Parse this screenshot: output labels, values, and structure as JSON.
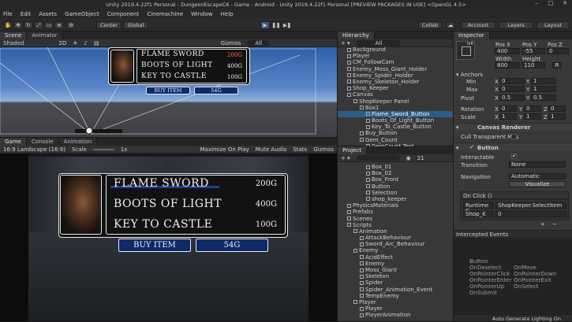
{
  "window": {
    "title": "Unity 2019.4.22f1 Personal - DungeonEscapeC6 - Game - Android - Unity 2019.4.22f1 Personal [PREVIEW PACKAGES IN USE] <OpenGL 4.5>"
  },
  "menu": [
    "File",
    "Edit",
    "Assets",
    "GameObject",
    "Component",
    "Cinemachine",
    "Window",
    "Help"
  ],
  "toolbar": {
    "center": "Center",
    "global": "Global",
    "collab": "Collab",
    "account": "Account",
    "layers": "Layers",
    "layout": "Layout"
  },
  "scene": {
    "tabs": [
      "Scene",
      "Animator"
    ],
    "shading": "Shaded",
    "mode2d": "2D",
    "gizmos": "Gizmos",
    "search": "All"
  },
  "game": {
    "tabs": [
      "Game",
      "Console",
      "Animation"
    ],
    "resolution": "16:9 Landscape (16:9)",
    "scale_label": "Scale",
    "scale_value": "1x",
    "options": [
      "Maximize On Play",
      "Mute Audio",
      "Stats",
      "Gizmos"
    ]
  },
  "shop": {
    "items": [
      {
        "name": "FLAME SWORD",
        "price": "200G"
      },
      {
        "name": "BOOTS OF LIGHT",
        "price": "400G"
      },
      {
        "name": "KEY TO CASTLE",
        "price": "100G"
      }
    ],
    "buy_label": "BUY ITEM",
    "gems": "54G"
  },
  "hierarchy": {
    "title": "Hierarchy",
    "search": "All",
    "rows": [
      {
        "label": "Background",
        "indent": 1,
        "sel": false
      },
      {
        "label": "Player",
        "indent": 1,
        "sel": false
      },
      {
        "label": "CM_FollowCam",
        "indent": 1,
        "sel": false
      },
      {
        "label": "Enemy_Moss_Giant_Holder",
        "indent": 1,
        "sel": false
      },
      {
        "label": "Enemy_Spider_Holder",
        "indent": 1,
        "sel": false
      },
      {
        "label": "Enemy_Skeleton_Holder",
        "indent": 1,
        "sel": false
      },
      {
        "label": "Shop_Keeper",
        "indent": 1,
        "sel": false
      },
      {
        "label": "Canvas",
        "indent": 1,
        "sel": false
      },
      {
        "label": "ShopKeeper Panel",
        "indent": 2,
        "sel": false
      },
      {
        "label": "Box1",
        "indent": 3,
        "sel": false
      },
      {
        "label": "Flame_Sword_Button",
        "indent": 4,
        "sel": true
      },
      {
        "label": "Boots_Of_Light_Button",
        "indent": 4,
        "sel": false
      },
      {
        "label": "Key_To_Castle_Button",
        "indent": 4,
        "sel": false
      },
      {
        "label": "Buy_Button",
        "indent": 3,
        "sel": false
      },
      {
        "label": "Gem_Count",
        "indent": 3,
        "sel": false
      },
      {
        "label": "GemCount Text",
        "indent": 4,
        "sel": false
      }
    ]
  },
  "project": {
    "title": "Project",
    "search": "",
    "count": "21",
    "rows": [
      {
        "label": "Box_01",
        "indent": 4
      },
      {
        "label": "Box_02",
        "indent": 4
      },
      {
        "label": "Box_Front",
        "indent": 4
      },
      {
        "label": "Button",
        "indent": 4
      },
      {
        "label": "Selection",
        "indent": 4
      },
      {
        "label": "shop_keeper",
        "indent": 4
      },
      {
        "label": "PhysicsMaterials",
        "indent": 1
      },
      {
        "label": "Prefabs",
        "indent": 1
      },
      {
        "label": "Scenes",
        "indent": 1
      },
      {
        "label": "Scripts",
        "indent": 1
      },
      {
        "label": "Animation",
        "indent": 2
      },
      {
        "label": "AttackBehaviour",
        "indent": 3
      },
      {
        "label": "Sword_Arc_Behaviour",
        "indent": 3
      },
      {
        "label": "Enemy",
        "indent": 2
      },
      {
        "label": "AcidEffect",
        "indent": 3
      },
      {
        "label": "Enemy",
        "indent": 3
      },
      {
        "label": "Moss_Giant",
        "indent": 3
      },
      {
        "label": "Skeleton",
        "indent": 3
      },
      {
        "label": "Spider",
        "indent": 3
      },
      {
        "label": "Spider_Animation_Event",
        "indent": 3
      },
      {
        "label": "TempEnemy",
        "indent": 3
      },
      {
        "label": "Player",
        "indent": 2
      },
      {
        "label": "Player",
        "indent": 3
      },
      {
        "label": "PlayerAnimation",
        "indent": 3
      }
    ]
  },
  "inspector": {
    "title": "Inspector",
    "anchor_preset": "left",
    "posx_label": "Pos X",
    "posy_label": "Pos Y",
    "posz_label": "Pos Z",
    "posx": "400",
    "posy": "-55",
    "posz": "0",
    "width_label": "Width",
    "height_label": "Height",
    "width": "800",
    "height": "110",
    "anchors": "Anchors",
    "min": "Min",
    "max": "Max",
    "min_x": "0",
    "min_y": "1",
    "max_x": "0",
    "max_y": "1",
    "pivot": "Pivot",
    "pivot_x": "0.5",
    "pivot_y": "0.5",
    "rotation": "Rotation",
    "rot_x": "0",
    "rot_y": "0",
    "rot_z": "0",
    "scale": "Scale",
    "sc_x": "1",
    "sc_y": "1",
    "sc_z": "1",
    "canvas_renderer": "Canvas Renderer",
    "cull": "Cull Transparent Mes",
    "button": "Button",
    "interactable": "Interactable",
    "transition": "Transition",
    "transition_value": "None",
    "navigation": "Navigation",
    "navigation_value": "Automatic",
    "visualize": "Visualize",
    "onclick": "On Click ()",
    "runtime": "Runtime C",
    "method": "ShopKeeper.SelectItem",
    "target": "Shop_K",
    "arg": "0",
    "intercepted": "Intercepted Events",
    "events_title": "Button",
    "events_left": [
      "OnDeselect",
      "OnPointerClick",
      "OnPointerEnter",
      "OnPointerUp",
      "OnSubmit"
    ],
    "events_right": [
      "OnMove",
      "OnPointerDown",
      "OnPointerExit",
      "OnSelect"
    ]
  },
  "status": {
    "right": "Auto Generate Lighting On"
  }
}
